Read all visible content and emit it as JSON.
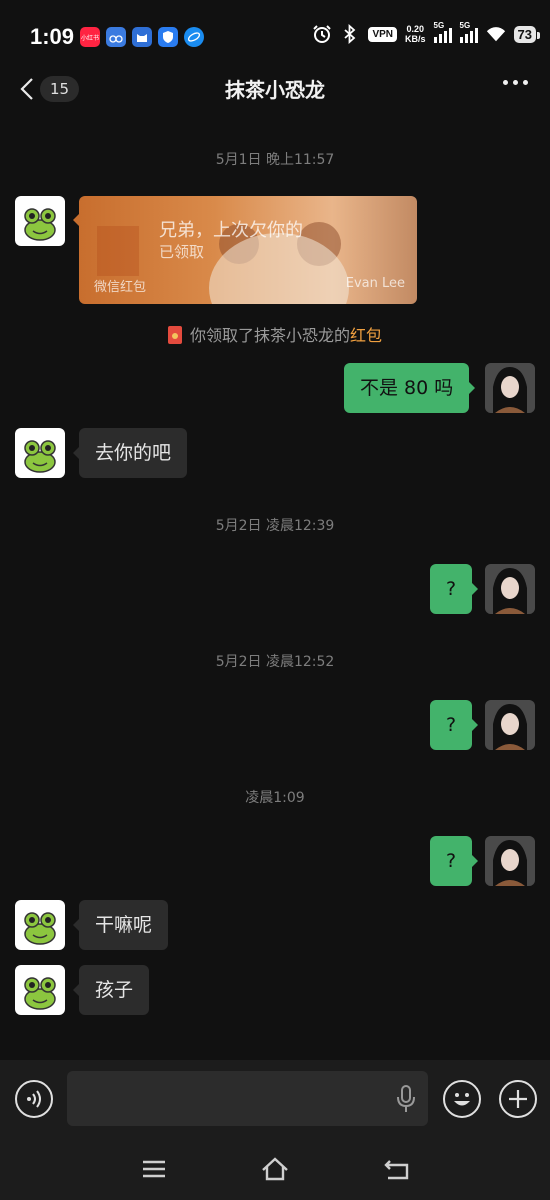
{
  "status_bar": {
    "time": "1:09",
    "net_speed_value": "0.20",
    "net_speed_unit": "KB/s",
    "vpn": "VPN",
    "sim1": "5G",
    "sim2": "5G",
    "battery": "73",
    "app_icons": [
      {
        "name": "xiaohongshu-icon",
        "color": "#ff2442",
        "label": "小红书"
      },
      {
        "name": "app-bike-icon",
        "color": "#3b7be0",
        "label": ""
      },
      {
        "name": "app-cat-icon",
        "color": "#2f6fd6",
        "label": ""
      },
      {
        "name": "app-shield-icon",
        "color": "#2a7cf0",
        "label": ""
      },
      {
        "name": "app-browser-icon",
        "color": "#1a8cf0",
        "label": ""
      }
    ]
  },
  "header": {
    "title": "抹茶小恐龙",
    "unread_count": "15"
  },
  "messages": [
    {
      "type": "timestamp",
      "text": "5月1日 晚上11:57"
    },
    {
      "type": "redpacket",
      "sender": "contact",
      "title": "兄弟，上次欠你的",
      "status": "已领取",
      "footer": "微信红包",
      "author": "Evan Lee"
    },
    {
      "type": "system",
      "prefix": "你领取了抹茶小恐龙的",
      "link": "红包"
    },
    {
      "type": "text",
      "sender": "me",
      "text": "不是 80 吗"
    },
    {
      "type": "text",
      "sender": "contact",
      "text": "去你的吧"
    },
    {
      "type": "timestamp",
      "text": "5月2日 凌晨12:39"
    },
    {
      "type": "text",
      "sender": "me",
      "text": "?"
    },
    {
      "type": "timestamp",
      "text": "5月2日 凌晨12:52"
    },
    {
      "type": "text",
      "sender": "me",
      "text": "?"
    },
    {
      "type": "timestamp",
      "text": "凌晨1:09"
    },
    {
      "type": "text",
      "sender": "me",
      "text": "?"
    },
    {
      "type": "text",
      "sender": "contact",
      "text": "干嘛呢"
    },
    {
      "type": "text",
      "sender": "contact",
      "text": "孩子"
    }
  ],
  "input_bar": {
    "placeholder": "",
    "icons": [
      "voice-icon",
      "microphone-icon",
      "emoji-icon",
      "plus-icon"
    ]
  },
  "nav_bar": {
    "icons": [
      "menu-icon",
      "home-icon",
      "back-nav-icon"
    ]
  },
  "colors": {
    "background": "#111111",
    "my_bubble": "#43b36b",
    "their_bubble": "#2c2c2c",
    "link": "#f0a040"
  }
}
